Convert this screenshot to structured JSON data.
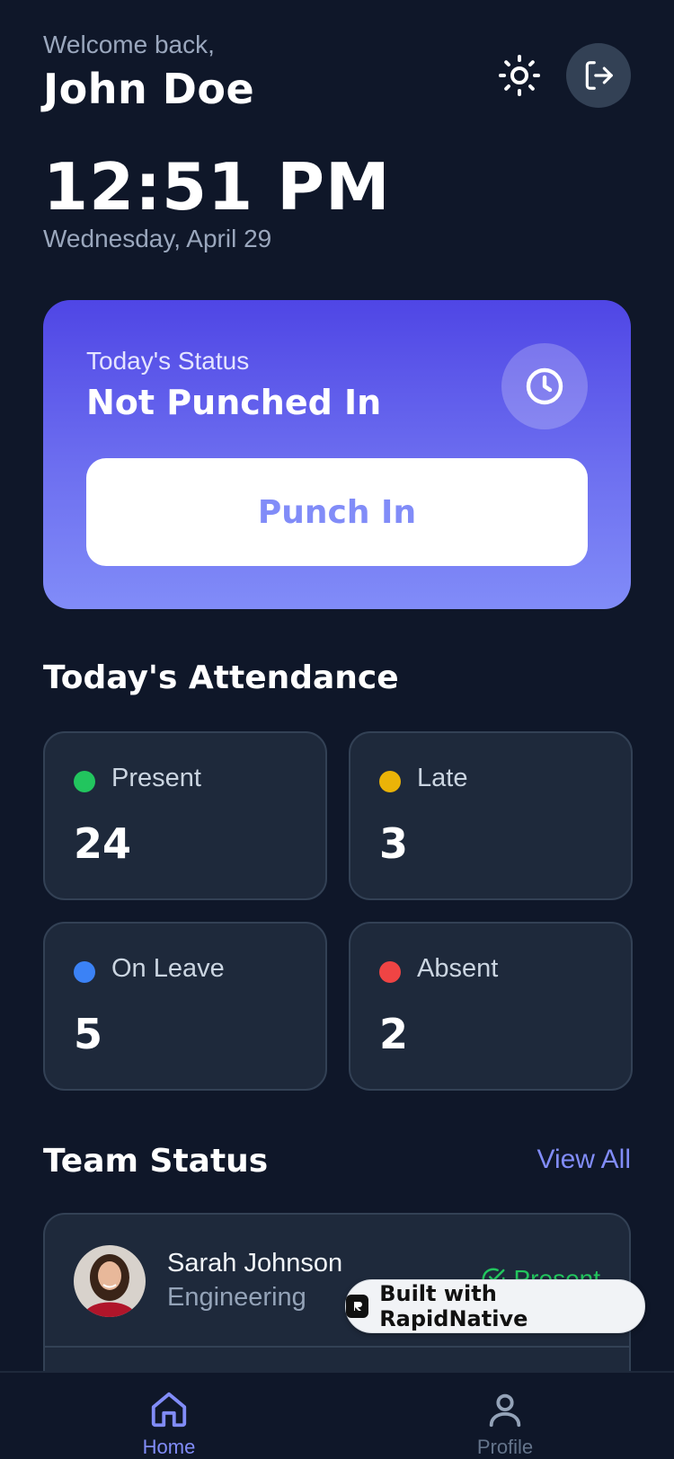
{
  "header": {
    "welcome": "Welcome back,",
    "user_name": "John Doe"
  },
  "clock": {
    "time": "12:51 PM",
    "date": "Wednesday, April 29"
  },
  "status_card": {
    "label": "Today's Status",
    "value": "Not Punched In",
    "button_label": "Punch In"
  },
  "attendance": {
    "title": "Today's Attendance",
    "stats": [
      {
        "label": "Present",
        "value": "24",
        "color": "#22c55e"
      },
      {
        "label": "Late",
        "value": "3",
        "color": "#eab308"
      },
      {
        "label": "On Leave",
        "value": "5",
        "color": "#3b82f6"
      },
      {
        "label": "Absent",
        "value": "2",
        "color": "#ef4444"
      }
    ]
  },
  "team": {
    "title": "Team Status",
    "view_all": "View All",
    "members": [
      {
        "name": "Sarah Johnson",
        "department": "Engineering",
        "status": "Present"
      }
    ]
  },
  "badge": {
    "label": "Built with RapidNative"
  },
  "nav": {
    "home": "Home",
    "profile": "Profile"
  },
  "colors": {
    "accent": "#818cf8",
    "background": "#0f1729",
    "card": "#1e293b"
  }
}
